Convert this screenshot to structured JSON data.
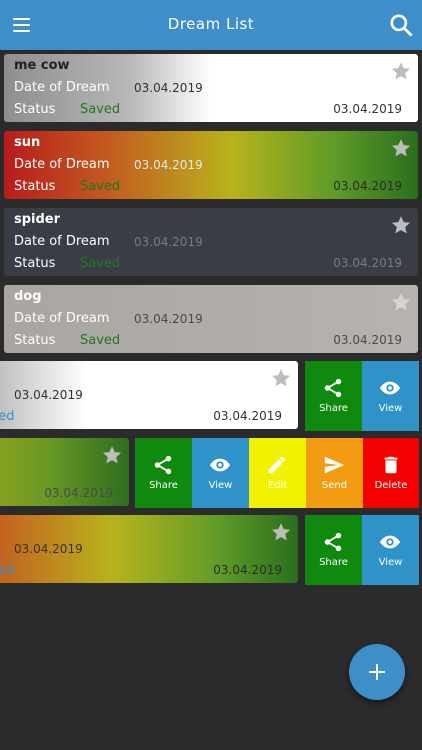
{
  "appbar": {
    "title": "Dream List",
    "menu_icon": "menu-icon",
    "search_icon": "search-icon",
    "color": "#3d8ec9"
  },
  "labels": {
    "date_of_dream": "Date of Dream",
    "status": "Status",
    "saved": "Saved"
  },
  "dreams": [
    {
      "name": "me cow",
      "date": "03.04.2019",
      "status": "Saved",
      "date2": "03.04.2019"
    },
    {
      "name": "sun",
      "date": "03.04.2019",
      "status": "Saved",
      "date2": "03.04.2019"
    },
    {
      "name": "spider",
      "date": "03.04.2019",
      "status": "Saved",
      "date2": "03.04.2019"
    },
    {
      "name": "dog",
      "date": "03.04.2019",
      "status": "Saved",
      "date2": "03.04.2019"
    },
    {
      "date": "03.04.2019",
      "status_partial": "tted",
      "date2": "03.04.2019"
    },
    {
      "date2": "03.04.2019"
    },
    {
      "date": "03.04.2019",
      "status_partial": "tted",
      "date2": "03.04.2019"
    }
  ],
  "actions": {
    "share": "Share",
    "view": "View",
    "edit": "Edit",
    "send": "Send",
    "delete": "Delete"
  },
  "colors": {
    "share": "#0f8a0f",
    "view": "#2f93c9",
    "edit": "#f2f200",
    "send": "#f39c12",
    "delete": "#f40000",
    "saved_status": "#1e7a1e",
    "background": "#2b2b2b"
  },
  "fab_icon": "add-icon"
}
